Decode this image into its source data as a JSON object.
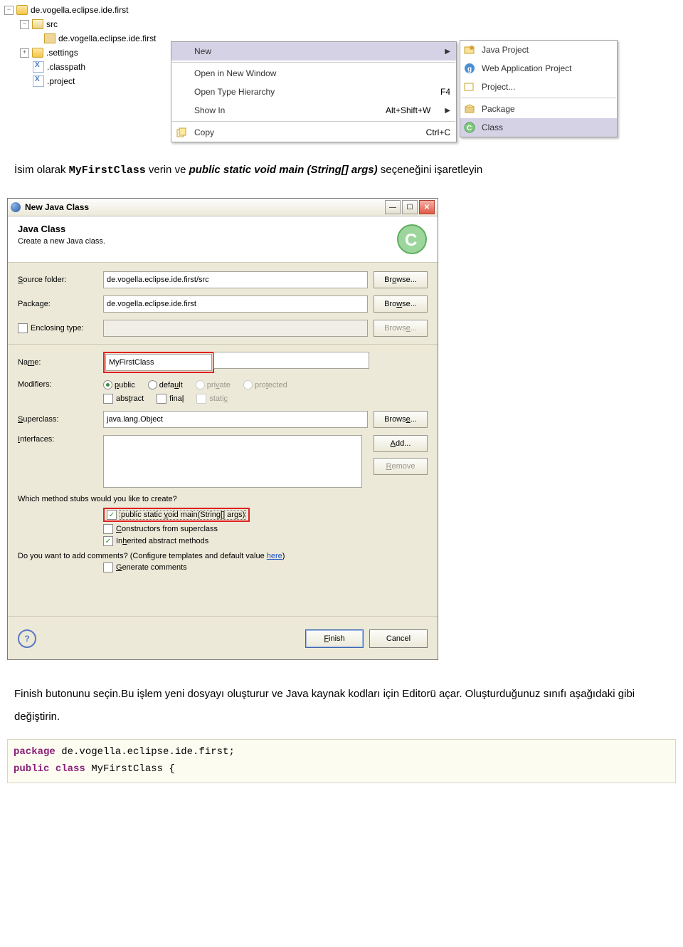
{
  "tree": {
    "project": "de.vogella.eclipse.ide.first",
    "src": "src",
    "pkg": "de.vogella.eclipse.ide.first",
    "settings": ".settings",
    "classpath": ".classpath",
    "projectfile": ".project"
  },
  "ctx": {
    "new": "New",
    "openNewWindow": "Open in New Window",
    "openTypeHierarchy": "Open Type Hierarchy",
    "openTypeHierarchyKey": "F4",
    "showIn": "Show In",
    "showInKey": "Alt+Shift+W",
    "copy": "Copy",
    "copyKey": "Ctrl+C"
  },
  "submenu": {
    "javaProject": "Java Project",
    "webApp": "Web Application Project",
    "project": "Project...",
    "package": "Package",
    "class": "Class"
  },
  "article1": {
    "pre": "İsim olarak ",
    "className": "MyFirstClass",
    "mid": " verin ve ",
    "sig": "public static void main (String[] args)",
    "post": " seçeneğini işaretleyin"
  },
  "dialog": {
    "title": "New Java Class",
    "heading": "Java Class",
    "sub": "Create a new Java class.",
    "srcFolderLbl": "Source folder:",
    "srcFolderVal": "de.vogella.eclipse.ide.first/src",
    "browse": "Browse...",
    "pkgLbl": "Package:",
    "pkgVal": "de.vogella.eclipse.ide.first",
    "enclosing": "Enclosing type:",
    "nameLbl": "Name:",
    "nameVal": "MyFirstClass",
    "modLbl": "Modifiers:",
    "modPublic": "public",
    "modDefault": "default",
    "modPrivate": "private",
    "modProtected": "protected",
    "modAbstract": "abstract",
    "modFinal": "final",
    "modStatic": "static",
    "superLbl": "Superclass:",
    "superVal": "java.lang.Object",
    "ifaceLbl": "Interfaces:",
    "add": "Add...",
    "remove": "Remove",
    "stubsQ": "Which method stubs would you like to create?",
    "stubMain": "public static void main(String[] args)",
    "stubCons": "Constructors from superclass",
    "stubInh": "Inherited abstract methods",
    "commentsQ1": "Do you want to add comments? (Configure templates and default value ",
    "commentsHere": "here",
    "commentsQ2": ")",
    "genComments": "Generate comments",
    "finish": "Finish",
    "cancel": "Cancel"
  },
  "article2": {
    "p1": "Finish butonunu seçin.Bu işlem yeni dosyayı oluşturur ve Java kaynak kodları için Editorü açar.  Oluşturduğunuz sınıfı aşağıdaki gibi değiştirin."
  },
  "code": {
    "pkgKw": "package",
    "pkgName": "de.vogella.eclipse.ide.first;",
    "pubKw": "public",
    "clsKw": "class",
    "clsName": "MyFirstClass {"
  }
}
